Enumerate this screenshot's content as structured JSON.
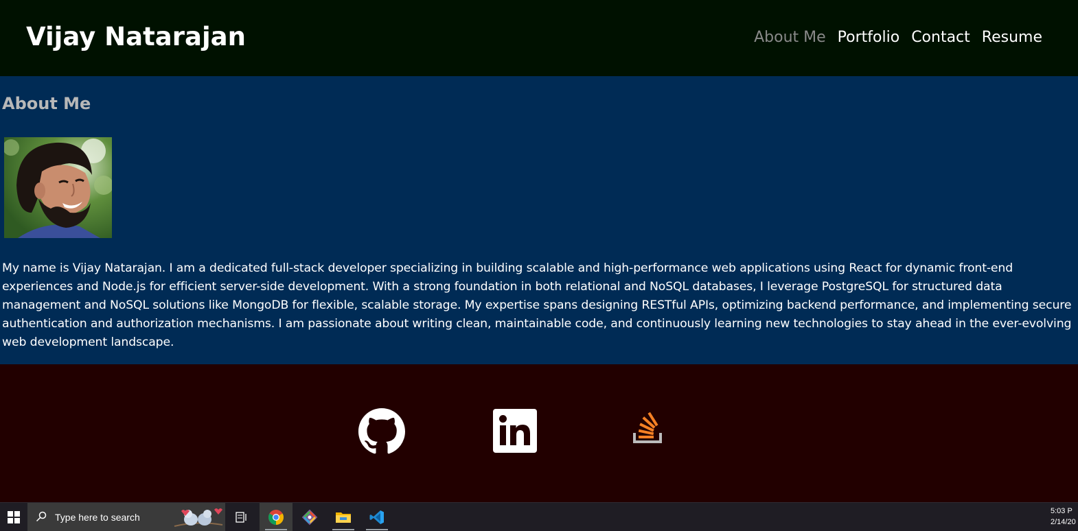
{
  "header": {
    "brand": "Vijay Natarajan",
    "nav": [
      {
        "label": "About Me",
        "active": true
      },
      {
        "label": "Portfolio",
        "active": false
      },
      {
        "label": "Contact",
        "active": false
      },
      {
        "label": "Resume",
        "active": false
      }
    ]
  },
  "about": {
    "heading": "About Me",
    "bio": "My name is Vijay Natarajan. I am a dedicated full-stack developer specializing in building scalable and high-performance web applications using React for dynamic front-end experiences and Node.js for efficient server-side development. With a strong foundation in both relational and NoSQL databases, I leverage PostgreSQL for structured data management and NoSQL solutions like MongoDB for flexible, scalable storage. My expertise spans designing RESTful APIs, optimizing backend performance, and implementing secure authentication and authorization mechanisms. I am passionate about writing clean, maintainable code, and continuously learning new technologies to stay ahead in the ever-evolving web development landscape."
  },
  "footer": {
    "social": [
      {
        "icon": "github-icon"
      },
      {
        "icon": "linkedin-icon"
      },
      {
        "icon": "stackoverflow-icon"
      }
    ]
  },
  "colors": {
    "header_bg": "#001100",
    "about_bg": "#002b55",
    "footer_bg": "#220000",
    "nav_active": "#8a8a8a",
    "stackoverflow_orange": "#f48024"
  },
  "taskbar": {
    "search_placeholder": "Type here to search",
    "apps": [
      "task-view-icon",
      "chrome-icon",
      "git-icon",
      "file-explorer-icon",
      "vscode-icon"
    ],
    "time": "5:03 P",
    "date": "2/14/20"
  }
}
